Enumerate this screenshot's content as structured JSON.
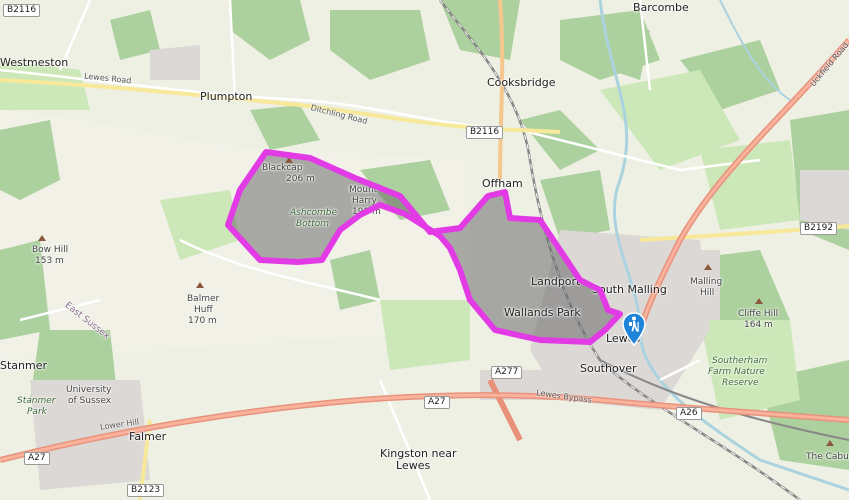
{
  "map": {
    "route_color": "#e23be6",
    "area_fill": "#6b6b6b",
    "marker_icon": "hiker-icon",
    "marker_color": "#1f84d8",
    "places": {
      "barcombe": "Barcombe",
      "westmeston": "Westmeston",
      "plumpton": "Plumpton",
      "cooksbridge": "Cooksbridge",
      "offham": "Offham",
      "south_malling": "South Malling",
      "landport": "Landport",
      "wallands_park": "Wallands Park",
      "lewes": "Lewes",
      "southover": "Southover",
      "kingston": "Kingston near",
      "kingston2": "Lewes",
      "falmer": "Falmer",
      "stanmer": "Stanmer",
      "university": "University",
      "university2": "of Sussex",
      "east_sussex": "East Sussex"
    },
    "hills": {
      "blackcap": "Blackcap",
      "blackcap_height": "206 m",
      "mount_harry": "Mount",
      "mount_harry2": "Harry",
      "mount_harry_height": "190 m",
      "ashcombe": "Ashcombe",
      "ashcombe2": "Bottom",
      "bow_hill": "Bow Hill",
      "bow_hill_height": "153 m",
      "balmer_huff": "Balmer",
      "balmer_huff2": "Huff",
      "balmer_huff_height": "170 m",
      "malling_hill": "Malling",
      "malling_hill2": "Hill",
      "cliffe_hill": "Cliffe Hill",
      "cliffe_hill_height": "164 m",
      "caburn": "The Cabur"
    },
    "parks": {
      "stanmer_park": "Stanmer",
      "stanmer_park2": "Park",
      "southerham": "Southerham",
      "southerham2": "Farm Nature",
      "southerham3": "Reserve"
    },
    "roads": {
      "b2116_a": "B2116",
      "b2116_b": "B2116",
      "b2192": "B2192",
      "a277": "A277",
      "a27_a": "A27",
      "a27_b": "A27",
      "a26": "A26",
      "b2123": "B2123",
      "lewes_road": "Lewes Road",
      "ditchling_road": "Ditchling Road",
      "lewes_bypass": "Lewes Bypass",
      "lower_hill": "Lower Hill",
      "uckfield_road": "Uckfield Road"
    }
  }
}
